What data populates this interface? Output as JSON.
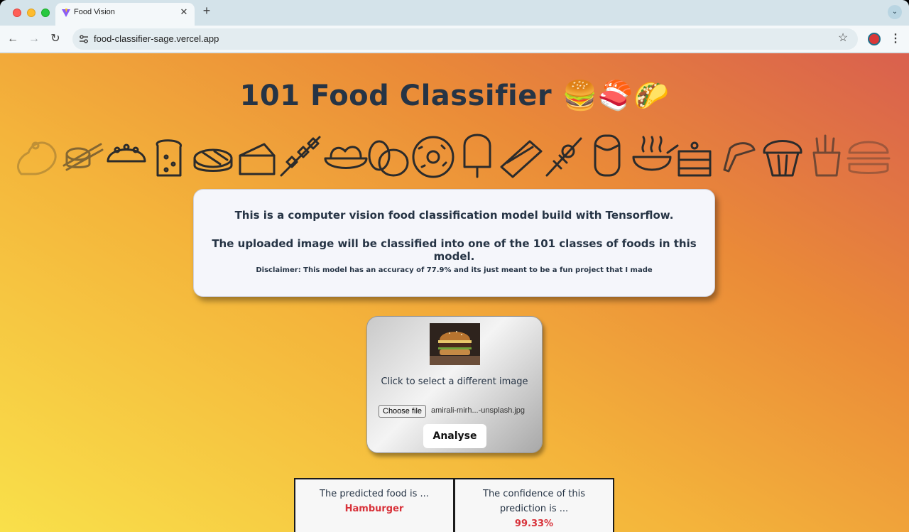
{
  "browser": {
    "tab_title": "Food Vision",
    "url": "food-classifier-sage.vercel.app"
  },
  "page": {
    "title": "101 Food Classifier 🍔🍣🌮",
    "info": {
      "line1": "This is a computer vision food classification model build with Tensorflow.",
      "line2": "The uploaded image will be classified into one of the 101 classes of foods in this model.",
      "line3": "Disclaimer: This model has an accuracy of 77.9% and its just meant to be a fun project that I made"
    },
    "upload": {
      "select_text": "Click to select a different image",
      "choose_label": "Choose file",
      "file_name": "amirali-mirh...-unsplash.jpg",
      "analyse_label": "Analyse"
    },
    "results": {
      "food_label": "The predicted food is ...",
      "food_value": "Hamburger",
      "confidence_label_1": "The confidence of this",
      "confidence_label_2": "prediction is ...",
      "confidence_value": "99.33%"
    },
    "icons": [
      "steak-icon",
      "sushi-icon",
      "taco-icon",
      "toast-icon",
      "pie-icon",
      "cake-slice-icon",
      "skewer-icon",
      "salad-bowl-icon",
      "egg-icon",
      "donut-icon",
      "popsicle-icon",
      "sandwich-icon",
      "kebab-icon",
      "burrito-icon",
      "soup-icon",
      "layer-cake-icon",
      "chicken-wing-icon",
      "muffin-icon",
      "fries-icon",
      "burger-icon"
    ]
  },
  "colors": {
    "title_text": "#263445",
    "result_value": "#d8323a",
    "bg_gradient_start": "#f9e04a",
    "bg_gradient_end": "#d9604e"
  }
}
